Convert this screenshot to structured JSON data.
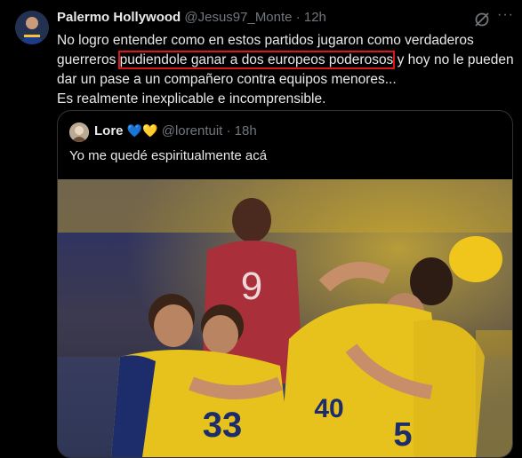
{
  "tweet": {
    "name": "Palermo Hollywood",
    "handle": "@Jesus97_Monte",
    "dot": "·",
    "time": "12h",
    "more_icon": "···",
    "text_part1": "No logro entender como en estos partidos jugaron como verdaderos guerreros ",
    "text_highlight": "pudiendole ganar a dos europeos poderosos",
    "text_part2": " y hoy no le pueden dar un pase a un compañero contra equipos menores...",
    "text_line2": "Es realmente inexplicable e incomprensible."
  },
  "quote": {
    "name": "Lore",
    "hearts": [
      "💙",
      "💛"
    ],
    "handle": "@lorentuit",
    "dot": "·",
    "time": "18h",
    "text": "Yo me quedé espiritualmente acá"
  },
  "photo": {
    "jersey_numbers": [
      "9",
      "33",
      "40",
      "5"
    ]
  },
  "colors": {
    "background": "#000000",
    "text": "#e7e9ea",
    "secondary": "#71767b",
    "highlight_box": "#e0151c",
    "border": "#2f3336"
  }
}
